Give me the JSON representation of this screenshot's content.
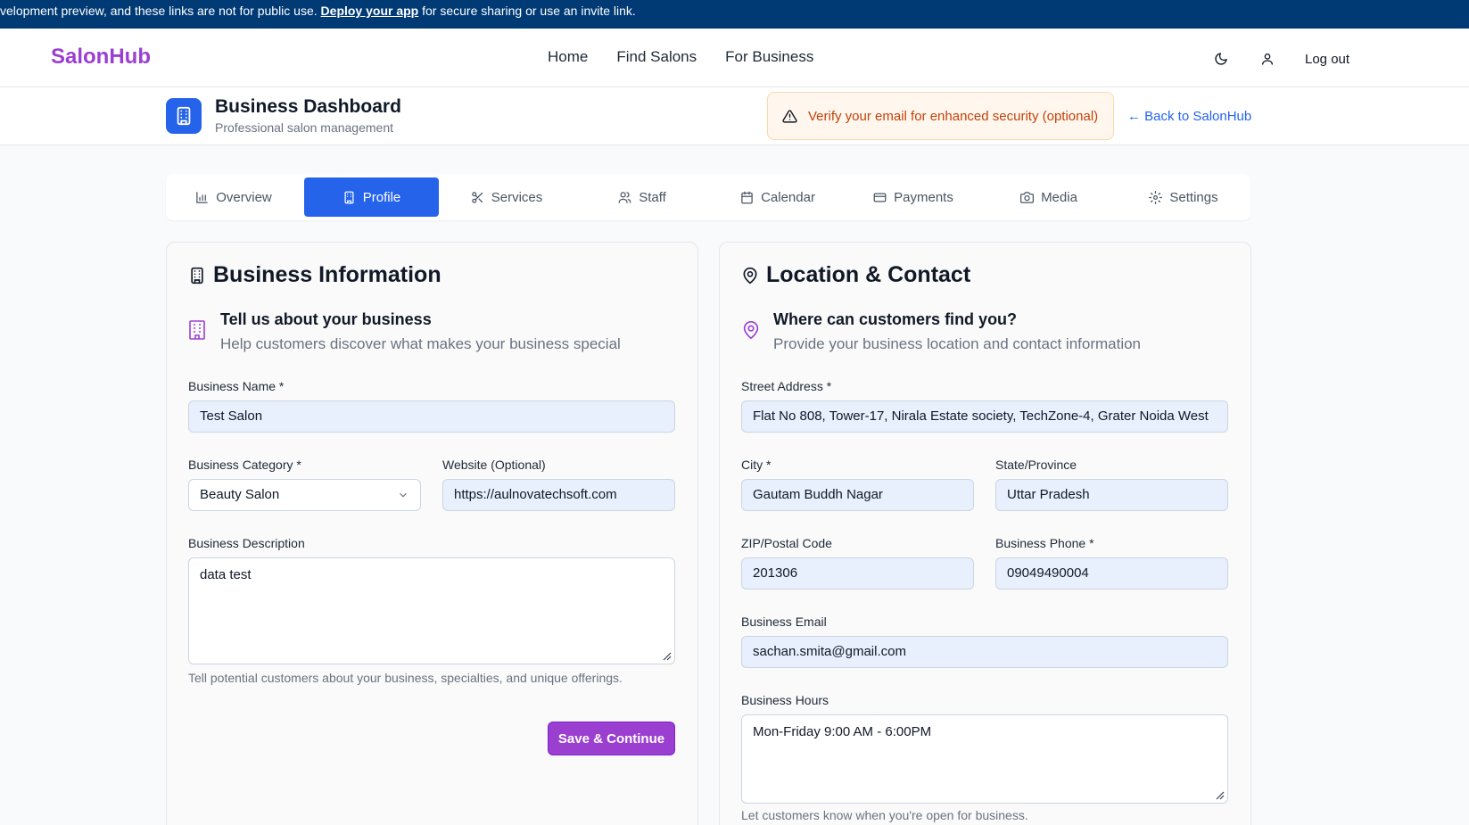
{
  "banner": {
    "text_before": "velopment preview, and these links are not for public use. ",
    "link": "Deploy your app",
    "text_after": " for secure sharing or use an invite link."
  },
  "nav": {
    "logo": "SalonHub",
    "links": [
      "Home",
      "Find Salons",
      "For Business"
    ],
    "logout": "Log out"
  },
  "dashboard": {
    "title": "Business Dashboard",
    "subtitle": "Professional salon management",
    "verify_notice": "Verify your email for enhanced security (optional)",
    "back_link": "← Back to SalonHub"
  },
  "tabs": [
    "Overview",
    "Profile",
    "Services",
    "Staff",
    "Calendar",
    "Payments",
    "Media",
    "Settings"
  ],
  "active_tab": "Profile",
  "business_info": {
    "title": "Business Information",
    "intro_heading": "Tell us about your business",
    "intro_text": "Help customers discover what makes your business special",
    "name_label": "Business Name *",
    "name_value": "Test Salon",
    "category_label": "Business Category *",
    "category_value": "Beauty Salon",
    "website_label": "Website (Optional)",
    "website_value": "https://aulnovatechsoft.com",
    "description_label": "Business Description",
    "description_value": "data test",
    "description_help": "Tell potential customers about your business, specialties, and unique offerings.",
    "save_button": "Save & Continue"
  },
  "location": {
    "title": "Location & Contact",
    "intro_heading": "Where can customers find you?",
    "intro_text": "Provide your business location and contact information",
    "street_label": "Street Address *",
    "street_value": "Flat No 808, Tower-17, Nirala Estate society, TechZone-4, Grater Noida West",
    "city_label": "City *",
    "city_value": "Gautam Buddh Nagar",
    "state_label": "State/Province",
    "state_value": "Uttar Pradesh",
    "zip_label": "ZIP/Postal Code",
    "zip_value": "201306",
    "phone_label": "Business Phone *",
    "phone_value": "09049490004",
    "email_label": "Business Email",
    "email_value": "sachan.smita@gmail.com",
    "hours_label": "Business Hours",
    "hours_value": "Mon-Friday 9:00 AM - 6:00PM",
    "hours_help": "Let customers know when you're open for business."
  },
  "colors": {
    "brand_purple": "#9b3fd1",
    "primary_blue": "#2563eb",
    "banner_navy": "#003a75",
    "warning_orange": "#c2410c"
  }
}
